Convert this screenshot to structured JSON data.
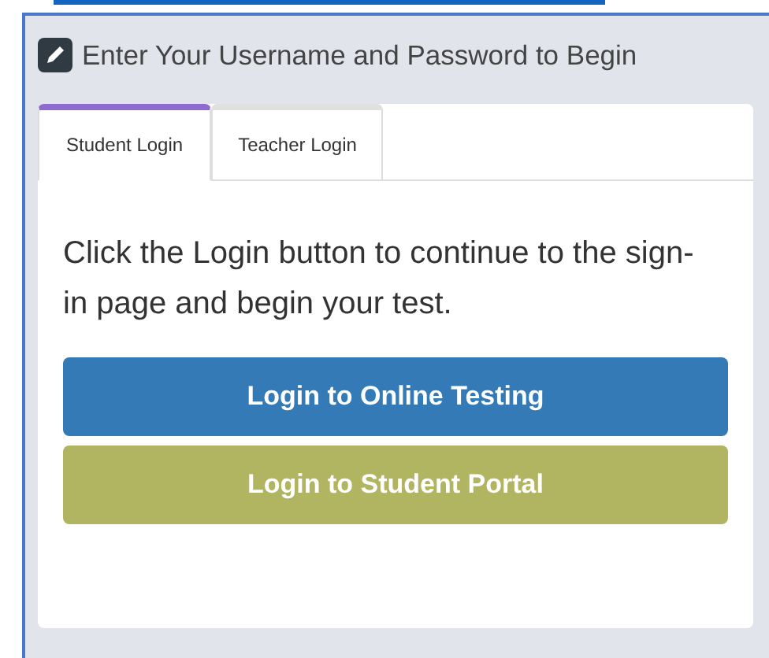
{
  "panel": {
    "title": "Enter Your Username and Password to Begin"
  },
  "tabs": [
    {
      "label": "Student Login",
      "selected": true
    },
    {
      "label": "Teacher Login",
      "selected": false
    }
  ],
  "message": "Click the Login button to continue to the sign-in page and begin your test.",
  "buttons": [
    {
      "label": "Login to Online Testing",
      "kind": "primary"
    },
    {
      "label": "Login to Student Portal",
      "kind": "secondary"
    }
  ]
}
